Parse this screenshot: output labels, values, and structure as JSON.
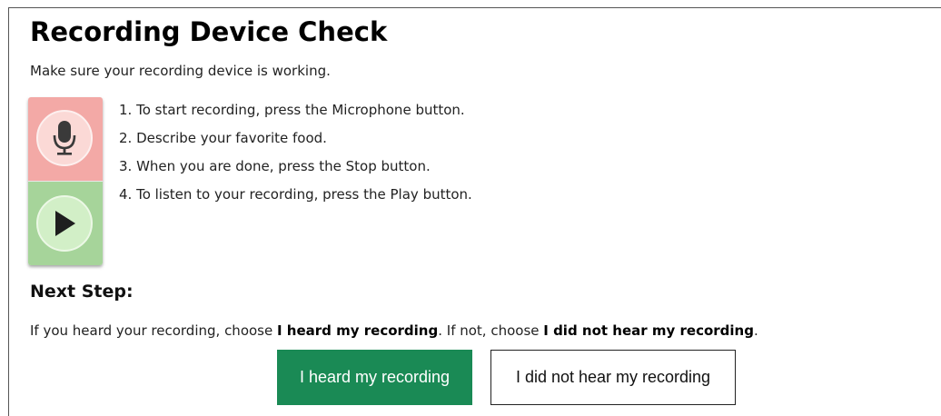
{
  "page": {
    "title": "Recording Device Check",
    "subtitle": "Make sure your recording device is working."
  },
  "device": {
    "colors": {
      "record_panel": "#f3a9a6",
      "play_panel": "#a6d49a"
    }
  },
  "steps": [
    "1. To start recording, press the Microphone button.",
    "2. Describe your favorite food.",
    "3. When you are done, press the Stop button.",
    "4. To listen to your recording, press the Play button."
  ],
  "next_step": {
    "heading": "Next Step:",
    "instruction": {
      "part1": "If you heard your recording, choose ",
      "bold1": "I heard my recording",
      "part2": ". If not, choose ",
      "bold2": "I did not hear my recording",
      "part3": "."
    },
    "buttons": {
      "heard": "I heard my recording",
      "not_heard": "I did not hear my recording"
    },
    "colors": {
      "heard_button": "#1a8a55"
    }
  }
}
